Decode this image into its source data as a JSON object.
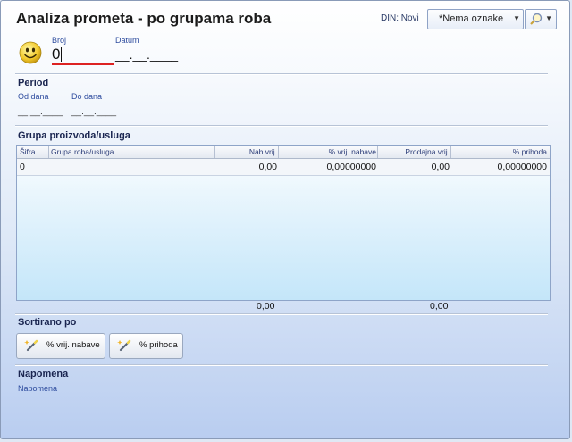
{
  "header": {
    "title": "Analiza prometa - po grupama roba",
    "din_label": "DIN: Novi",
    "tag_combo_value": "*Nema oznake"
  },
  "doc": {
    "broj_label": "Broj",
    "broj_value": "0",
    "datum_label": "Datum",
    "datum_value": "__.__.____"
  },
  "period": {
    "title": "Period",
    "od_label": "Od dana",
    "od_value": "__.__.____",
    "do_label": "Do dana",
    "do_value": "__.__.____"
  },
  "grupa": {
    "title": "Grupa proizvoda/usluga",
    "columns": [
      "Šifra",
      "Grupa roba/usluga",
      "Nab.vrij.",
      "% vrij. nabave",
      "Prodajna vrij.",
      "% prihoda"
    ],
    "rows": [
      [
        "0",
        "",
        "0,00",
        "0,00000000",
        "0,00",
        "0,00000000"
      ]
    ],
    "totals": {
      "nab": "0,00",
      "prod": "0,00"
    }
  },
  "sort": {
    "title": "Sortirano po",
    "btn_nabave": "% vrij. nabave",
    "btn_prihoda": "% prihoda"
  },
  "napomena": {
    "title": "Napomena",
    "value": "Napomena"
  },
  "colors": {
    "accent_underline": "#dd2222",
    "label_blue": "#2e4c9e"
  },
  "icons": [
    "smiley-icon",
    "search-icon",
    "chevron-down-icon",
    "magic-wand-icon"
  ]
}
